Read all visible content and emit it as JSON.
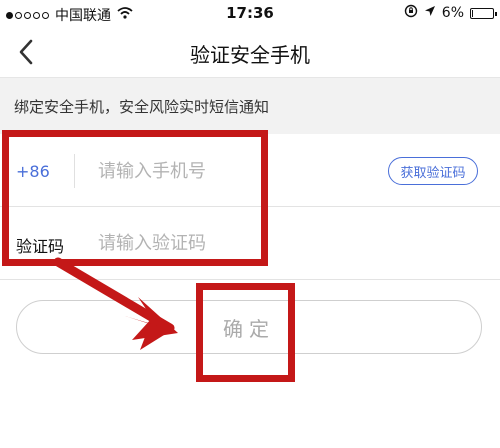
{
  "status_bar": {
    "carrier": "中国联通",
    "time": "17:36",
    "battery": "6%",
    "battery_level": 0.06,
    "signal_bars_filled": 1,
    "signal_bars_total": 5,
    "icons": [
      "wifi-icon",
      "lock-rotation-icon",
      "location-arrow-icon",
      "battery-icon"
    ]
  },
  "nav": {
    "title": "验证安全手机",
    "back_icon": "chevron-left-icon"
  },
  "notice": {
    "text": "绑定安全手机，安全风险实时短信通知"
  },
  "form": {
    "country_code": "+86",
    "phone_placeholder": "请输入手机号",
    "phone_value": "",
    "get_code_label": "获取验证码",
    "code_label": "验证码",
    "code_placeholder": "请输入验证码",
    "code_value": ""
  },
  "confirm": {
    "label": "确定"
  },
  "colors": {
    "accent": "#4a6fd9",
    "annotation": "#c41818",
    "notice_bg": "#f2f2f2",
    "placeholder": "#b3b3b3"
  }
}
